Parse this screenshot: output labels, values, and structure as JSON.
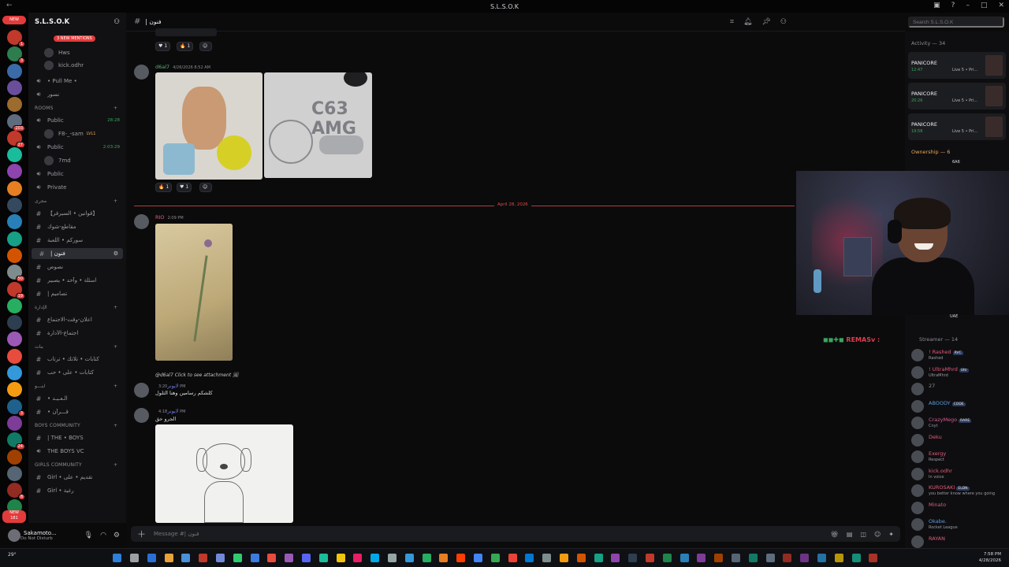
{
  "window": {
    "title": "S.L.S.O.K"
  },
  "server": {
    "name": "S.L.S.O.K",
    "mentions_pill": "3 NEW MENTIONS"
  },
  "rail": {
    "top_pill": "NEW",
    "bottom_pill": "NEW",
    "bottom_pill_count": "181",
    "badges": [
      "1",
      "3",
      "",
      "",
      "",
      "203",
      "27",
      "",
      "",
      "",
      "",
      "",
      "",
      "",
      "50",
      "19",
      "",
      "",
      "",
      "",
      "",
      "",
      "3",
      "",
      "24",
      "",
      "",
      "8",
      "",
      "97"
    ]
  },
  "sidebar": {
    "voice_users_top": [
      "Hws",
      "kick.odhr"
    ],
    "items": [
      {
        "kind": "voice",
        "label": "• Pull Me •"
      },
      {
        "kind": "voice",
        "label": "نسور"
      },
      {
        "kind": "category",
        "label": "ROOMS"
      },
      {
        "kind": "voice",
        "label": "Public",
        "time": "28:28"
      },
      {
        "kind": "user",
        "label": "F8-_-sam",
        "tag": "LVL1"
      },
      {
        "kind": "voice",
        "label": "Public",
        "time": "2:03:29"
      },
      {
        "kind": "user",
        "label": "7md"
      },
      {
        "kind": "voice",
        "label": "Public"
      },
      {
        "kind": "voice",
        "label": "Private"
      },
      {
        "kind": "category",
        "label": "مجرى"
      },
      {
        "kind": "text",
        "label": "【قوانين • السيرفر】"
      },
      {
        "kind": "text",
        "label": "مقاطع-شوك"
      },
      {
        "kind": "text",
        "label": "سوركم • اللعبة"
      },
      {
        "kind": "text",
        "label": "| فنون",
        "selected": true
      },
      {
        "kind": "text",
        "label": "نصوص"
      },
      {
        "kind": "text",
        "label": "اسئلة • وآحد • يصبير"
      },
      {
        "kind": "text",
        "label": "| تصاميم"
      },
      {
        "kind": "category",
        "label": "الإدارة"
      },
      {
        "kind": "text",
        "label": "اعلان-وقت-الاجتماع"
      },
      {
        "kind": "text",
        "label": "اجتماع-الأدارة"
      },
      {
        "kind": "category",
        "label": "بنات"
      },
      {
        "kind": "text",
        "label": "كتابات • تلاتك • ترتاب"
      },
      {
        "kind": "text",
        "label": "كتابات • على • حب"
      },
      {
        "kind": "category",
        "label": "ابنـــو"
      },
      {
        "kind": "text",
        "label": "• الـعـيـد"
      },
      {
        "kind": "text",
        "label": "• قـــرآن"
      },
      {
        "kind": "category",
        "label": "Boys Community"
      },
      {
        "kind": "text",
        "label": "| THE • BOYS"
      },
      {
        "kind": "voice",
        "label": "THE BOYS VC"
      },
      {
        "kind": "category",
        "label": "Girls Community"
      },
      {
        "kind": "text",
        "label": "Girl • تقديم • على"
      },
      {
        "kind": "text",
        "label": "Girl • رغية"
      }
    ]
  },
  "user_panel": {
    "name": "Sakamoto...",
    "status": "Do Not Disturb"
  },
  "channel": {
    "name": "| فنون",
    "search_placeholder": "Search S.L.S.O.K"
  },
  "messages": [
    {
      "author": "",
      "reactions": [
        {
          "emoji": "♥",
          "count": "1"
        },
        {
          "emoji": "🔥",
          "count": "1"
        }
      ]
    },
    {
      "author": "d6al7",
      "timestamp": "4/26/2026 8:52 AM",
      "reactions": [
        {
          "emoji": "🔥",
          "count": "1"
        },
        {
          "emoji": "♥",
          "count": "1"
        }
      ],
      "image_text": "C63 AMG"
    },
    {
      "author": "RIO",
      "timestamp": "2:09 PM"
    },
    {
      "reply": "@d6al7 Click to see attachment",
      "author": "لايونر",
      "timestamp": "3:20 PM",
      "text": "كلشكم رسامين وهنا الثلول"
    },
    {
      "author": "لايونر",
      "timestamp": "4:18 PM",
      "text": "الجرو حق"
    }
  ],
  "divider": {
    "label": "April 28, 2026"
  },
  "composer": {
    "placeholder": "Message #| فنون"
  },
  "right_panel": {
    "activity_title": "Activity — 34",
    "activities": [
      {
        "title": "PANICORE",
        "time": "12:47",
        "detail": "Live 5 • Pri..."
      },
      {
        "title": "PANICORE",
        "time": "20:26",
        "detail": "Live 5 • Pri..."
      },
      {
        "title": "PANICORE",
        "time": "19:58",
        "detail": "Live 5 • Pri..."
      }
    ],
    "ownership_title": "Ownership — 6",
    "ownership_tag": "6A6",
    "uae_tag": "UAE",
    "overlay_text": "REMASv :",
    "streamer_title": "Streamer — 14",
    "members": [
      {
        "name": "! Rashed",
        "tag": "RVC",
        "status": "Rashed",
        "color": "#e55b7a"
      },
      {
        "name": "! UltraMhrd",
        "tag": "Ultr",
        "status": "UltraMhrd",
        "color": "#e55b7a"
      },
      {
        "name": "27",
        "tag": "",
        "status": "",
        "color": "#8c8d93"
      },
      {
        "name": "ABOODY",
        "tag": "CODE",
        "status": "",
        "color": "#5c9be0"
      },
      {
        "name": "CrazyMego",
        "tag": "RARE",
        "status": "Cnyt",
        "color": "#d65c8e"
      },
      {
        "name": "Deku",
        "tag": "",
        "status": "",
        "color": "#e55b7a"
      },
      {
        "name": "Exergy",
        "tag": "",
        "status": "Respect",
        "color": "#e55b7a"
      },
      {
        "name": "kick.odhr",
        "tag": "",
        "status": "In voice",
        "color": "#e55b7a"
      },
      {
        "name": "KUROSAKI",
        "tag": "ELDN",
        "status": "you better know where you going",
        "color": "#e55b7a"
      },
      {
        "name": "Minato",
        "tag": "",
        "status": "",
        "color": "#e55b7a"
      },
      {
        "name": "Okabe.",
        "tag": "",
        "status": "Rocket League",
        "color": "#5c9be0"
      },
      {
        "name": "RAYAN",
        "tag": "",
        "status": "",
        "color": "#e55b7a"
      }
    ]
  },
  "taskbar": {
    "weather": "29°",
    "time": "7:58 PM",
    "date": "4/28/2026"
  }
}
